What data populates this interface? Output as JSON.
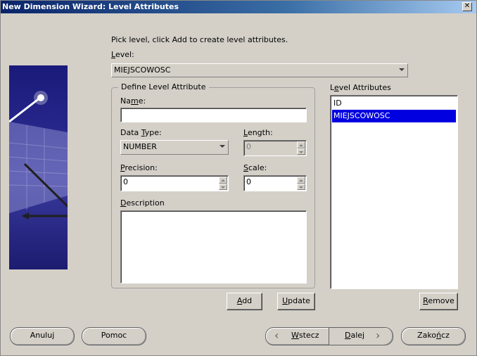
{
  "window": {
    "title": "New Dimension Wizard: Level Attributes",
    "close_glyph": "✕"
  },
  "instruction": "Pick level, click Add to create level attributes.",
  "level": {
    "label": "Level:",
    "value": "MIEJSCOWOSC"
  },
  "define_group": {
    "title": "Define Level Attribute",
    "name_label": "Name:",
    "name_value": "",
    "data_type_label": "Data Type:",
    "data_type_value": "NUMBER",
    "length_label": "Length:",
    "length_value": "0",
    "precision_label": "Precision:",
    "precision_value": "0",
    "scale_label": "Scale:",
    "scale_value": "0",
    "description_label": "Description",
    "description_value": ""
  },
  "level_attributes": {
    "label": "Level Attributes",
    "items": [
      {
        "label": "ID",
        "selected": false
      },
      {
        "label": "MIEJSCOWOSC",
        "selected": true
      }
    ]
  },
  "buttons": {
    "add": "Add",
    "update": "Update",
    "remove": "Remove",
    "cancel": "Anuluj",
    "help": "Pomoc",
    "back": "Wstecz",
    "next": "Dalej",
    "finish": "Zakończ"
  },
  "colors": {
    "dialog_bg": "#d4d0c8",
    "selection": "#0000e0",
    "title_start": "#0a246a"
  },
  "icons": {
    "back_arrow": "‹",
    "next_arrow": "›"
  }
}
